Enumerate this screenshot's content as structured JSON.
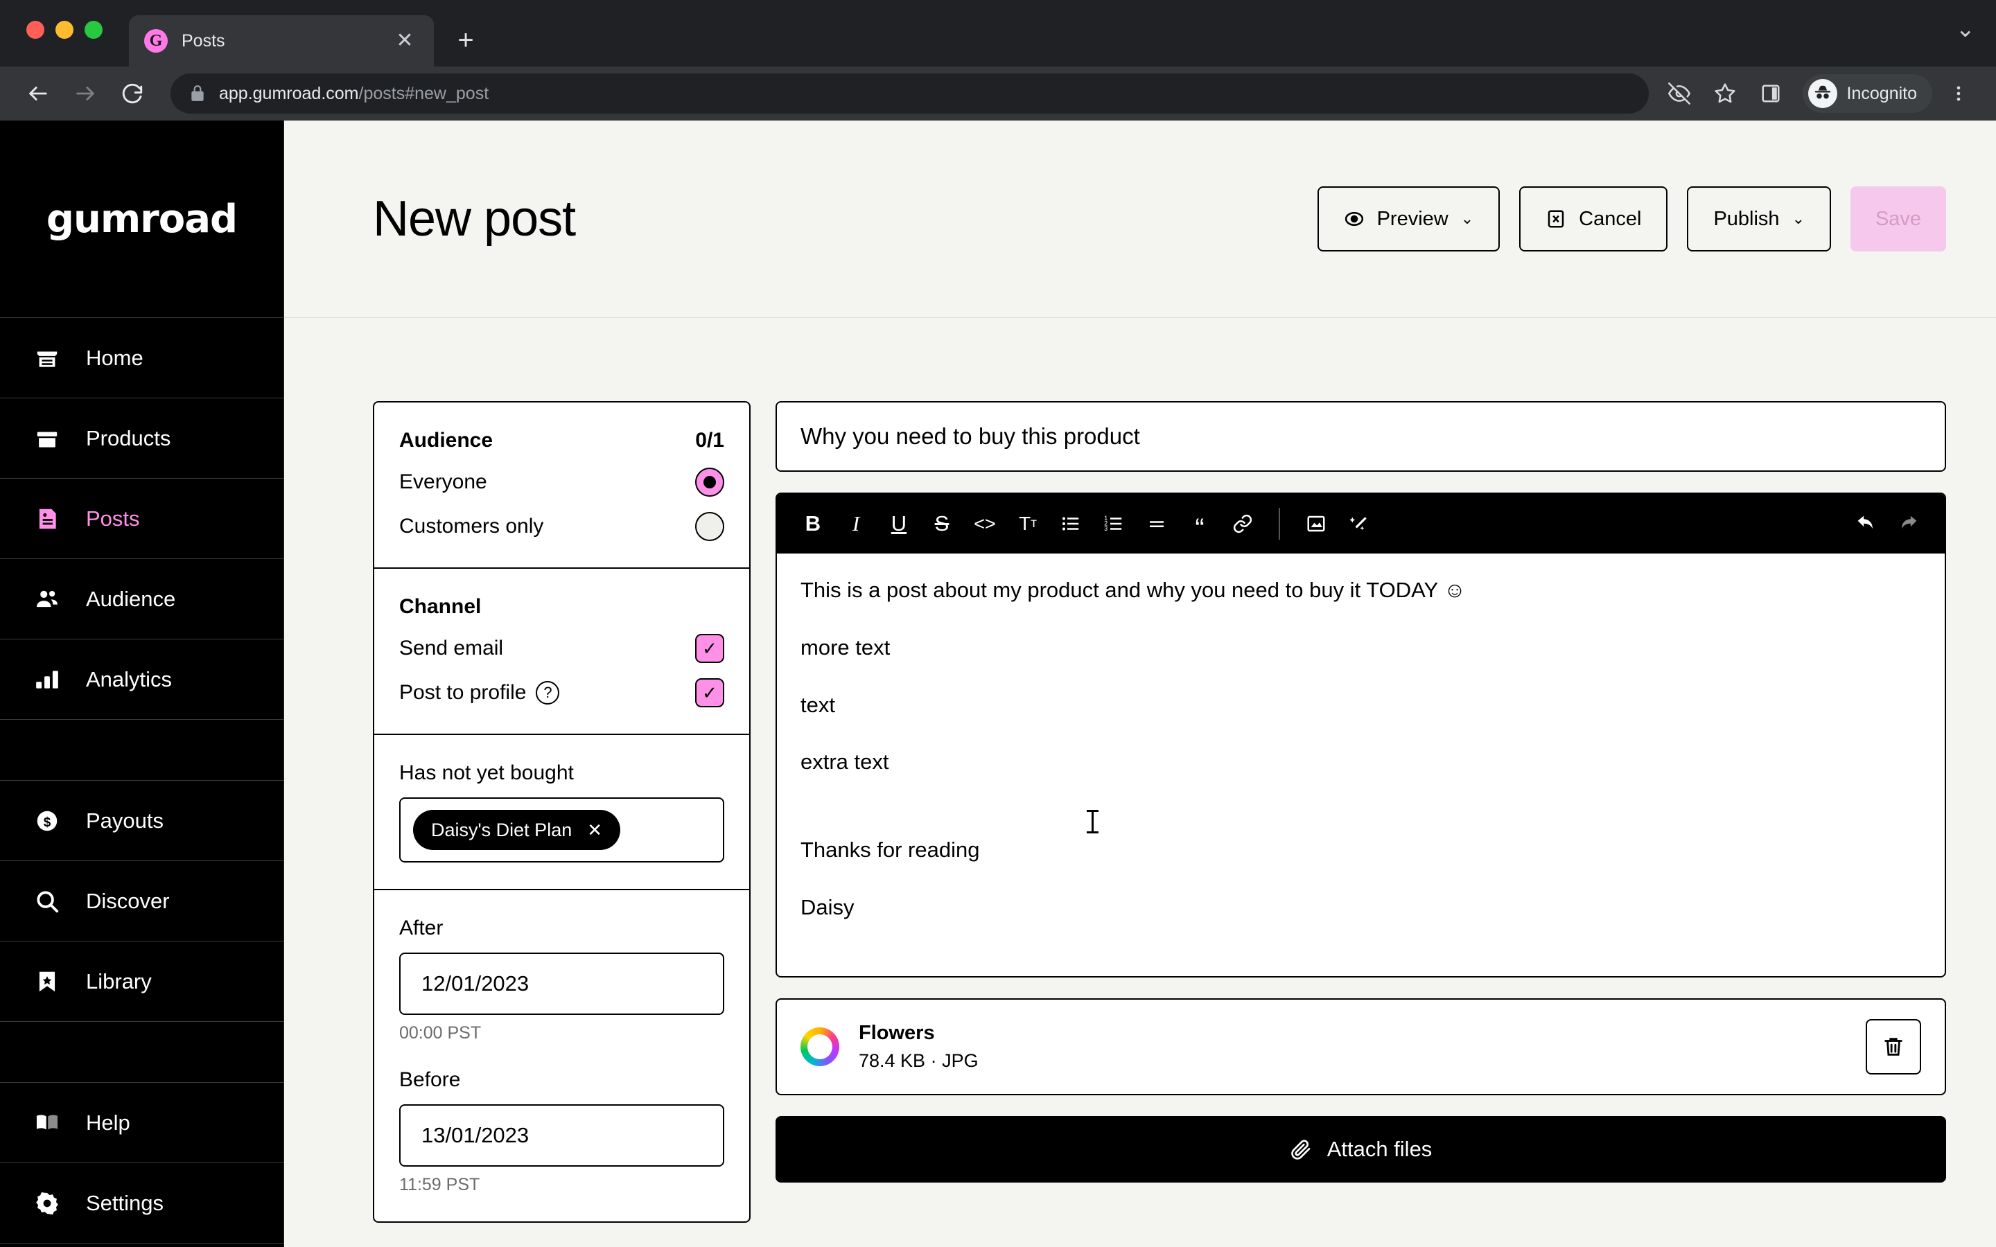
{
  "browser": {
    "tab": {
      "title": "Posts",
      "favicon_letter": "G",
      "close_icon": "close-icon"
    },
    "new_tab_label": "+",
    "tabstrip_menu_icon": "chevron-down-icon",
    "url_host": "app.gumroad.com",
    "url_path": "/posts#new_post",
    "profile_label": "Incognito"
  },
  "sidebar": {
    "brand": "gumroad",
    "items": [
      {
        "label": "Home",
        "icon": "storefront-icon",
        "active": false
      },
      {
        "label": "Products",
        "icon": "box-icon",
        "active": false
      },
      {
        "label": "Posts",
        "icon": "post-icon",
        "active": true
      },
      {
        "label": "Audience",
        "icon": "people-icon",
        "active": false
      },
      {
        "label": "Analytics",
        "icon": "bar-chart-icon",
        "active": false
      },
      {
        "label": "Payouts",
        "icon": "dollar-coin-icon",
        "active": false
      },
      {
        "label": "Discover",
        "icon": "search-icon",
        "active": false
      },
      {
        "label": "Library",
        "icon": "bookmark-icon",
        "active": false
      },
      {
        "label": "Help",
        "icon": "book-icon",
        "active": false
      },
      {
        "label": "Settings",
        "icon": "gear-icon",
        "active": false
      }
    ]
  },
  "header": {
    "title": "New post",
    "preview_label": "Preview",
    "cancel_label": "Cancel",
    "publish_label": "Publish",
    "save_label": "Save"
  },
  "audience": {
    "section_title": "Audience",
    "count": "0/1",
    "options": [
      {
        "label": "Everyone",
        "selected": true
      },
      {
        "label": "Customers only",
        "selected": false
      }
    ]
  },
  "channel": {
    "section_title": "Channel",
    "options": [
      {
        "label": "Send email",
        "checked": true,
        "help": false
      },
      {
        "label": "Post to profile",
        "checked": true,
        "help": true
      }
    ]
  },
  "not_bought": {
    "label": "Has not yet bought",
    "tags": [
      "Daisy's Diet Plan"
    ]
  },
  "date_range": {
    "after_label": "After",
    "after_value": "12/01/2023",
    "after_hint": "00:00 PST",
    "before_label": "Before",
    "before_value": "13/01/2023",
    "before_hint": "11:59 PST"
  },
  "post": {
    "title_value": "Why you need to buy this product",
    "body_paragraphs": [
      "This is a post about my product and why you need to buy it TODAY ☺",
      "more text",
      "text",
      "extra text",
      "",
      "Thanks for reading",
      "Daisy"
    ]
  },
  "editor_toolbar": {
    "buttons": [
      {
        "name": "bold-icon",
        "glyph": "B"
      },
      {
        "name": "italic-icon",
        "glyph": "I"
      },
      {
        "name": "underline-icon",
        "glyph": "U"
      },
      {
        "name": "strikethrough-icon",
        "glyph": "S"
      },
      {
        "name": "code-icon",
        "glyph": "<>"
      },
      {
        "name": "text-size-icon",
        "glyph": "Tт"
      },
      {
        "name": "bulleted-list-icon",
        "glyph": "•≡"
      },
      {
        "name": "numbered-list-icon",
        "glyph": "1≡"
      },
      {
        "name": "horizontal-rule-icon",
        "glyph": "≡"
      },
      {
        "name": "blockquote-icon",
        "glyph": "“"
      },
      {
        "name": "link-icon",
        "glyph": "🔗"
      },
      {
        "name": "insert-image-icon",
        "glyph": "▣"
      },
      {
        "name": "magic-wand-icon",
        "glyph": "✦"
      }
    ],
    "undo_icon": "undo-icon",
    "redo_icon": "redo-icon"
  },
  "attachment": {
    "name": "Flowers",
    "meta": "78.4 KB · JPG",
    "delete_icon": "trash-icon"
  },
  "attach_files": {
    "label": "Attach files",
    "icon": "paperclip-icon"
  },
  "colors": {
    "accent_pink": "#ff90e8",
    "save_disabled": "#f5c8ec",
    "page_bg": "#f4f4f0",
    "sidebar_bg": "#000000"
  }
}
